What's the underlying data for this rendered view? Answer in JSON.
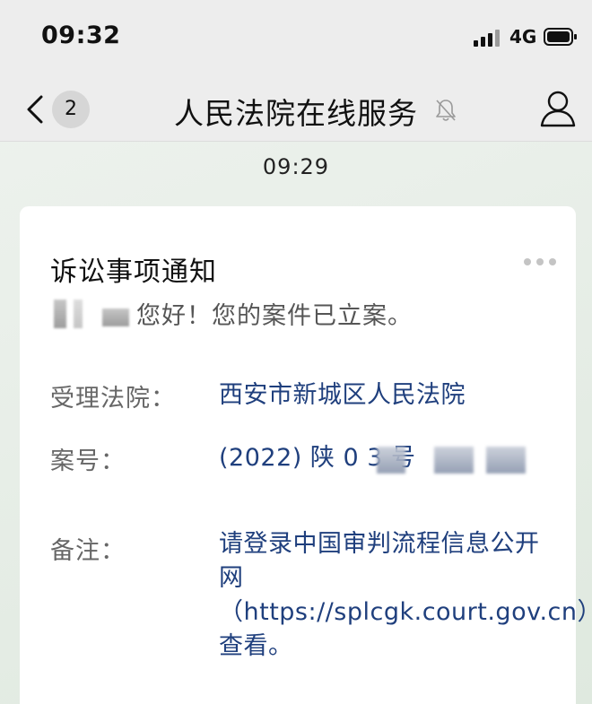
{
  "status_bar": {
    "time": "09:32",
    "network": "4G",
    "icons": [
      "signal-bars-icon",
      "battery-icon"
    ]
  },
  "nav": {
    "unread_count": "2",
    "title": "人民法院在线服务",
    "icons": [
      "back-chevron-icon",
      "mute-bell-icon",
      "profile-person-icon"
    ]
  },
  "chat": {
    "timestamp": "09:29"
  },
  "message_card": {
    "title": "诉讼事项通知",
    "greeting": "您好！您的案件已立案。",
    "fields": [
      {
        "label": "受理法院：",
        "value": "西安市新城区人民法院"
      },
      {
        "label": "案号：",
        "value": "(2022) 陕 0        3 号"
      },
      {
        "label": "备注：",
        "value": "请登录中国审判流程信息公开网（https://splcgk.court.gov.cn）查看。"
      }
    ],
    "more_icon": "more-dots-icon"
  },
  "colors": {
    "nav_background": "#ededed",
    "chat_background": "#e9efe9",
    "card_background": "#ffffff",
    "field_value_blue": "#1f3f7d",
    "label_gray": "#666666"
  }
}
